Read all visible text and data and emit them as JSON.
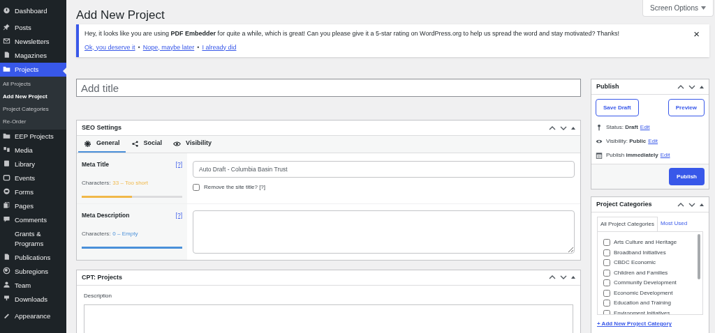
{
  "sidebar": {
    "items": [
      {
        "label": "Dashboard",
        "selected": false
      },
      {
        "label": "Posts",
        "selected": false
      },
      {
        "label": "Newsletters",
        "selected": false
      },
      {
        "label": "Magazines",
        "selected": false
      },
      {
        "label": "Projects",
        "selected": true,
        "children": [
          {
            "label": "All Projects",
            "selected": false
          },
          {
            "label": "Add New Project",
            "selected": true
          },
          {
            "label": "Project Categories",
            "selected": false
          },
          {
            "label": "Re-Order",
            "selected": false
          }
        ]
      },
      {
        "label": "EEP Projects",
        "selected": false
      },
      {
        "label": "Media",
        "selected": false
      },
      {
        "label": "Library",
        "selected": false
      },
      {
        "label": "Events",
        "selected": false
      },
      {
        "label": "Forms",
        "selected": false
      },
      {
        "label": "Pages",
        "selected": false
      },
      {
        "label": "Comments",
        "selected": false
      },
      {
        "label": "Grants & Programs",
        "selected": false
      },
      {
        "label": "Publications",
        "selected": false
      },
      {
        "label": "Subregions",
        "selected": false
      },
      {
        "label": "Team",
        "selected": false
      },
      {
        "label": "Downloads",
        "selected": false
      },
      {
        "label": "Appearance",
        "selected": false
      }
    ]
  },
  "page_title": "Add New Project",
  "screen_options": "Screen Options",
  "notice": {
    "text": "Hey, it looks like you are using **PDF Embedder** for quite a while, which is great! Can you please give it a 5-star rating on WordPress.org to help us spread the word and stay motivated? Thanks!",
    "links": [
      "Ok, you deserve it",
      "Nope, maybe later",
      "I already did"
    ],
    "separator": "•",
    "close": "×"
  },
  "title_field": {
    "placeholder": "Add title"
  },
  "seo": {
    "title": "SEO Settings",
    "tabs": [
      {
        "label": "General",
        "selected": true
      },
      {
        "label": "Social",
        "selected": false
      },
      {
        "label": "Visibility",
        "selected": false
      }
    ],
    "fields": [
      {
        "kind": "input",
        "label": "Meta Title",
        "help": "[?]",
        "count_label": "Characters:",
        "count": "33 – Too short",
        "color": "#f0b849",
        "level": 0.5,
        "value": "Auto Draft - Columbia Basin Trust",
        "checkbox": {
          "label": "Remove the site title? [?]",
          "checked": false
        }
      },
      {
        "kind": "textarea",
        "label": "Meta Description",
        "help": "[?]",
        "count_label": "Characters:",
        "count": "0 – Empty",
        "color": "#4a90d9",
        "level": 1
      }
    ]
  },
  "cpt": {
    "title": "CPT: Projects",
    "field_label": "Description"
  },
  "publish": {
    "title": "Publish",
    "save_draft": "Save Draft",
    "preview": "Preview",
    "rows": [
      {
        "label": "Status:",
        "value": "Draft",
        "edit": "Edit"
      },
      {
        "label": "Visibility:",
        "value": "Public",
        "edit": "Edit"
      },
      {
        "label": "Publish",
        "value": "immediately",
        "edit": "Edit"
      }
    ],
    "button": "Publish"
  },
  "categories": {
    "title": "Project Categories",
    "tabs": [
      {
        "label": "All Project Categories",
        "selected": true
      },
      {
        "label": "Most Used",
        "selected": false
      }
    ],
    "items": [
      {
        "label": "Arts Culture and Heritage",
        "checked": false
      },
      {
        "label": "Broadband Initiatives",
        "checked": false
      },
      {
        "label": "CBDC Economic",
        "checked": false
      },
      {
        "label": "Children and Families",
        "checked": false
      },
      {
        "label": "Community Development",
        "checked": false
      },
      {
        "label": "Economic Development",
        "checked": false
      },
      {
        "label": "Education and Training",
        "checked": false
      },
      {
        "label": "Environment Initiatives",
        "checked": false
      }
    ],
    "add_link": "+ Add New Project Category"
  }
}
